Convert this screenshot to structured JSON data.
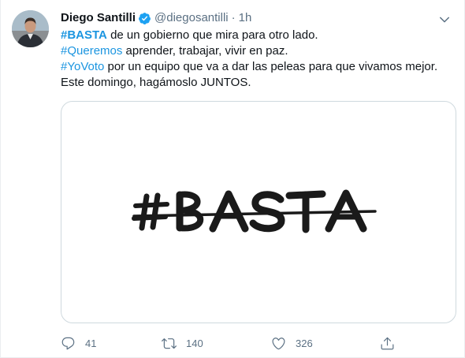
{
  "tweet": {
    "author_name": "Diego Santilli",
    "handle": "@diegosantilli",
    "separator": "·",
    "time": "1h",
    "lines": [
      {
        "tag": "#BASTA",
        "text": " de un gobierno que mira para otro lado."
      },
      {
        "tag": "#Queremos",
        "text": " aprender, trabajar, vivir en paz."
      },
      {
        "tag": "#YoVoto",
        "text": " por un equipo que va a dar las peleas para que vivamos mejor."
      },
      {
        "tag": "",
        "text": "Este domingo, hagámoslo JUNTOS."
      }
    ],
    "media_text": "#BASTA"
  },
  "actions": {
    "reply_count": "41",
    "retweet_count": "140",
    "like_count": "326"
  },
  "icons": [
    "verified-badge-icon",
    "chevron-down-icon",
    "reply-icon",
    "retweet-icon",
    "like-icon",
    "share-icon"
  ],
  "colors": {
    "link": "#1b95e0",
    "muted": "#5b7083",
    "verified": "#1da1f2"
  }
}
